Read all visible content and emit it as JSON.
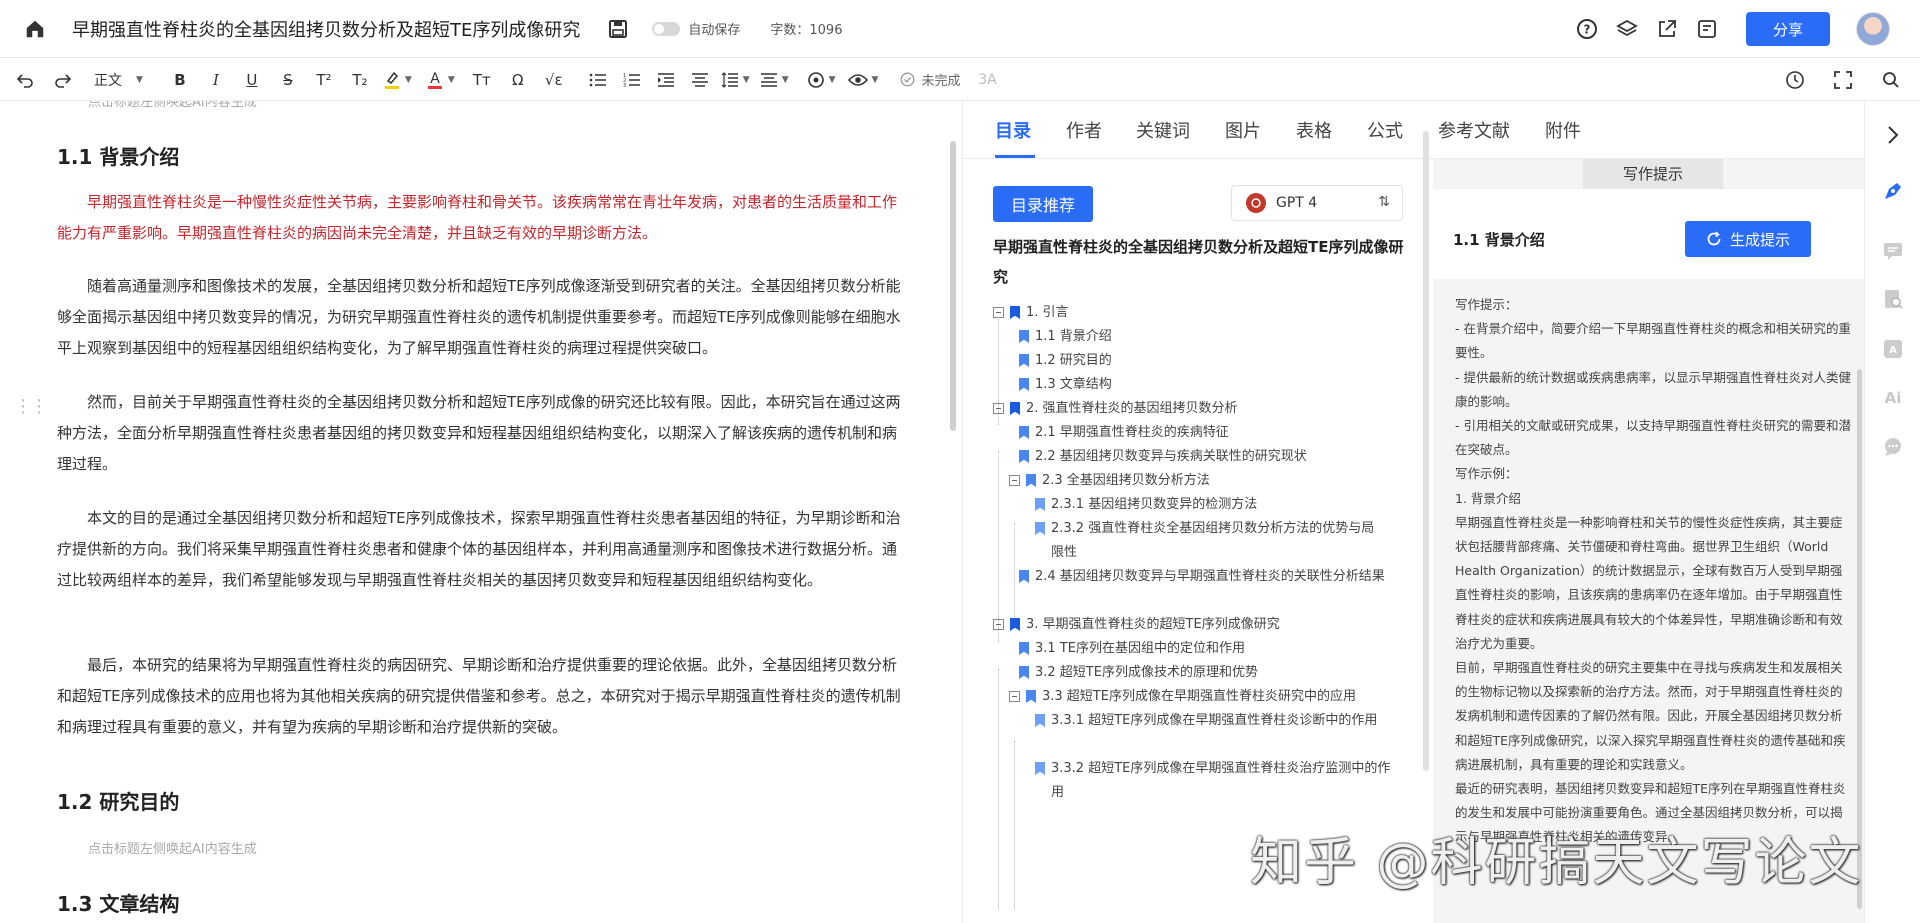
{
  "header": {
    "title": "早期强直性脊柱炎的全基因组拷贝数分析及超短TE序列成像研究",
    "autosave_label": "自动保存",
    "wordcount": "字数：1096",
    "share_label": "分享"
  },
  "toolbar": {
    "style_label": "正文",
    "superscript": "T²",
    "subscript": "T₂",
    "clear_format": "Tт",
    "omega": "Ω",
    "formula": "√ε",
    "status_label": "未完成",
    "ai_label": "3A"
  },
  "editor": {
    "hint_top": "点击标题左侧唤起AI内容生成",
    "sections": [
      {
        "heading": "1.1  背景介绍",
        "paragraphs": [
          "早期强直性脊柱炎是一种慢性炎症性关节病，主要影响脊柱和骨关节。该疾病常常在青壮年发病，对患者的生活质量和工作能力有严重影响。早期强直性脊柱炎的病因尚未完全清楚，并且缺乏有效的早期诊断方法。",
          "随着高通量测序和图像技术的发展，全基因组拷贝数分析和超短TE序列成像逐渐受到研究者的关注。全基因组拷贝数分析能够全面揭示基因组中拷贝数变异的情况，为研究早期强直性脊柱炎的遗传机制提供重要参考。而超短TE序列成像则能够在细胞水平上观察到基因组中的短程基因组组织结构变化，为了解早期强直性脊柱炎的病理过程提供突破口。",
          "然而，目前关于早期强直性脊柱炎的全基因组拷贝数分析和超短TE序列成像的研究还比较有限。因此，本研究旨在通过这两种方法，全面分析早期强直性脊柱炎患者基因组的拷贝数变异和短程基因组组织结构变化，以期深入了解该疾病的遗传机制和病理过程。",
          "本文的目的是通过全基因组拷贝数分析和超短TE序列成像技术，探索早期强直性脊柱炎患者基因组的特征，为早期诊断和治疗提供新的方向。我们将采集早期强直性脊柱炎患者和健康个体的基因组样本，并利用高通量测序和图像技术进行数据分析。通过比较两组样本的差异，我们希望能够发现与早期强直性脊柱炎相关的基因拷贝数变异和短程基因组组织结构变化。",
          "最后，本研究的结果将为早期强直性脊柱炎的病因研究、早期诊断和治疗提供重要的理论依据。此外，全基因组拷贝数分析和超短TE序列成像技术的应用也将为其他相关疾病的研究提供借鉴和参考。总之，本研究对于揭示早期强直性脊柱炎的遗传机制和病理过程具有重要的意义，并有望为疾病的早期诊断和治疗提供新的突破。"
        ]
      },
      {
        "heading": "1.2  研究目的",
        "hint": "点击标题左侧唤起AI内容生成"
      },
      {
        "heading": "1.3  文章结构"
      }
    ]
  },
  "panel": {
    "tabs": [
      "目录",
      "作者",
      "关键词",
      "图片",
      "表格",
      "公式",
      "参考文献",
      "附件"
    ],
    "toc_button": "目录推荐",
    "model_label": "GPT 4",
    "toc_title": "早期强直性脊柱炎的全基因组拷贝数分析及超短TE序列成像研究",
    "toc": [
      "1. 引言",
      "1.1 背景介绍",
      "1.2 研究目的",
      "1.3 文章结构",
      "2. 强直性脊柱炎的基因组拷贝数分析",
      "2.1 早期强直性脊柱炎的疾病特征",
      "2.2 基因组拷贝数变异与疾病关联性的研究现状",
      "2.3 全基因组拷贝数分析方法",
      "2.3.1 基因组拷贝数变异的检测方法",
      "2.3.2 强直性脊柱炎全基因组拷贝数分析方法的优势与局限性",
      "2.4 基因组拷贝数变异与早期强直性脊柱炎的关联性分析结果",
      "3. 早期强直性脊柱炎的超短TE序列成像研究",
      "3.1 TE序列在基因组中的定位和作用",
      "3.2 超短TE序列成像技术的原理和优势",
      "3.3 超短TE序列成像在早期强直性脊柱炎研究中的应用",
      "3.3.1 超短TE序列成像在早期强直性脊柱炎诊断中的作用",
      "3.3.2 超短TE序列成像在早期强直性脊柱炎治疗监测中的作用"
    ],
    "hints_tab": "写作提示",
    "hints_section": "1.1  背景介绍",
    "generate_label": "生成提示",
    "hints_text": "写作提示：\n- 在背景介绍中，简要介绍一下早期强直性脊柱炎的概念和相关研究的重要性。\n- 提供最新的统计数据或疾病患病率，以显示早期强直性脊柱炎对人类健康的影响。\n- 引用相关的文献或研究成果，以支持早期强直性脊柱炎研究的需要和潜在突破点。\n写作示例：\n1. 背景介绍\n早期强直性脊柱炎是一种影响脊柱和关节的慢性炎症性疾病，其主要症状包括腰背部疼痛、关节僵硬和脊柱弯曲。据世界卫生组织（World Health Organization）的统计数据显示，全球有数百万人受到早期强直性脊柱炎的影响，且该疾病的患病率仍在逐年增加。由于早期强直性脊柱炎的症状和疾病进展具有较大的个体差异性，早期准确诊断和有效治疗尤为重要。\n目前，早期强直性脊柱炎的研究主要集中在寻找与疾病发生和发展相关的生物标记物以及探索新的治疗方法。然而，对于早期强直性脊柱炎的发病机制和遗传因素的了解仍然有限。因此，开展全基因组拷贝数分析和超短TE序列成像研究，以深入探究早期强直性脊柱炎的遗传基础和疾病进展机制，具有重要的理论和实践意义。\n最近的研究表明，基因组拷贝数变异和超短TE序列在早期强直性脊柱炎的发生和发展中可能扮演重要角色。通过全基因组拷贝数分析，可以揭示与早期强直性脊柱炎相关的遗传变异。"
  },
  "watermark": "知乎 @科研搞天文写论文"
}
